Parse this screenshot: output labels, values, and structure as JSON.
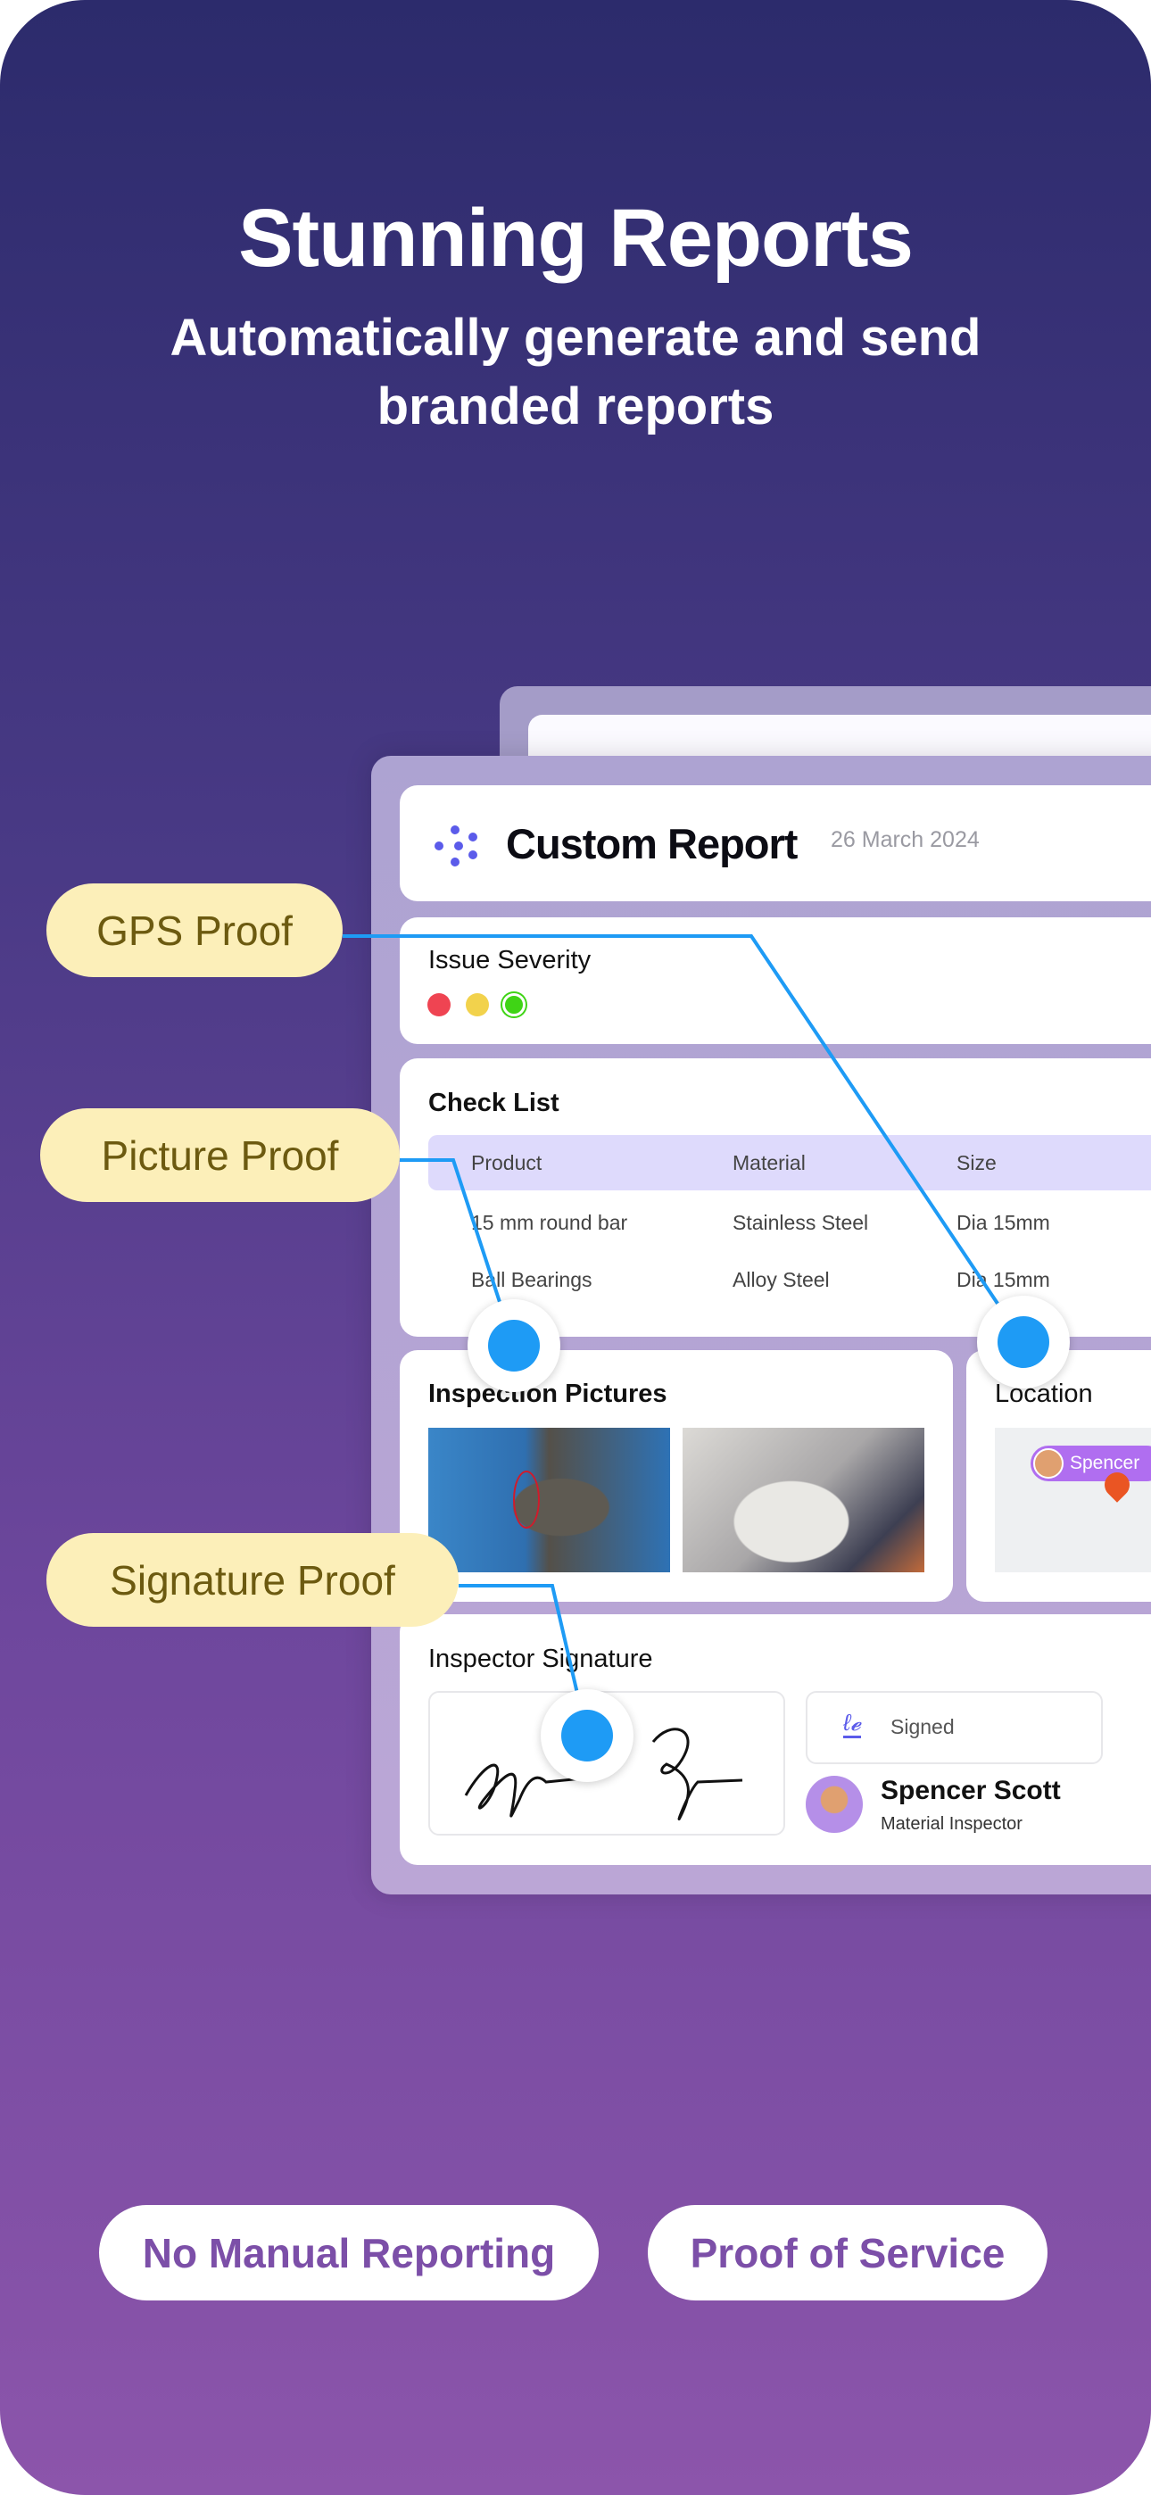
{
  "hero": {
    "title": "Stunning Reports",
    "subtitle_line1": "Automatically generate and send",
    "subtitle_line2": "branded reports"
  },
  "report": {
    "title": "Custom Report",
    "date": "26 March 2024",
    "severity": {
      "label": "Issue Severity",
      "levels": [
        {
          "color": "#ef4452"
        },
        {
          "color": "#f2d24c"
        },
        {
          "color": "#3fd415",
          "selected": true
        }
      ]
    },
    "checklist": {
      "label": "Check List",
      "columns": [
        "Product",
        "Material",
        "Size"
      ],
      "rows": [
        [
          "15 mm round bar",
          "Stainless Steel",
          "Dia 15mm"
        ],
        [
          "Ball Bearings",
          "Alloy Steel",
          "Dia 15mm"
        ]
      ]
    },
    "pictures": {
      "label": "Inspection Pictures"
    },
    "location": {
      "label": "Location",
      "map_tag": "Spencer"
    },
    "signature": {
      "label": "Inspector Signature",
      "status": "Signed",
      "name": "Spencer Scott",
      "role": "Material Inspector"
    }
  },
  "callouts": {
    "gps": "GPS Proof",
    "picture": "Picture Proof",
    "signature": "Signature Proof"
  },
  "badges": [
    "No Manual Reporting",
    "Proof of Service"
  ],
  "colors": {
    "accent_line": "#1e9bf5",
    "callout_bg": "#fcefb9",
    "badge_text": "#7c4fa8",
    "logo": "#5b5bea"
  }
}
